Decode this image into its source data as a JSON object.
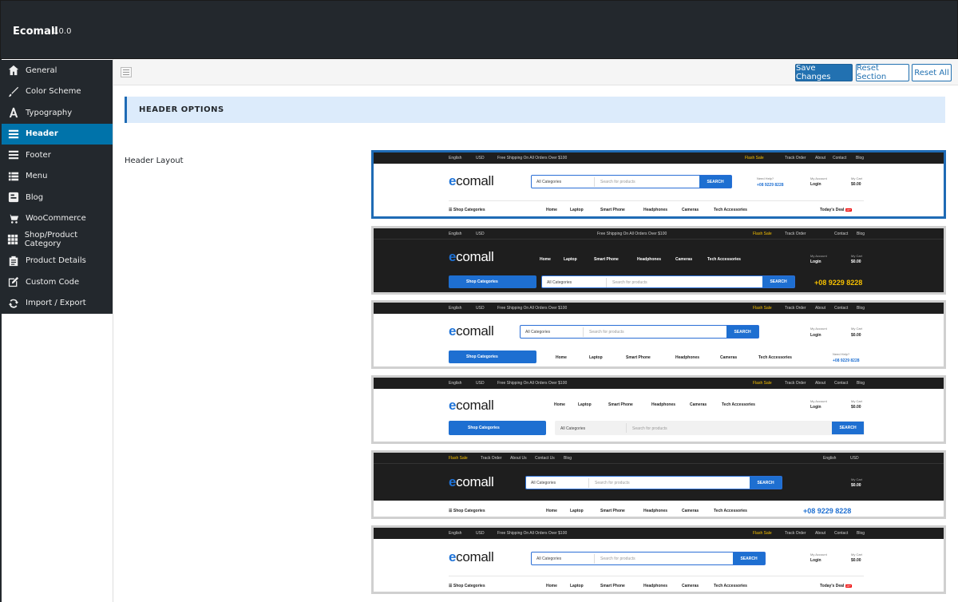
{
  "app": {
    "title": "Ecomall",
    "version": "1.0.0"
  },
  "sidebar": {
    "items": [
      {
        "label": "General",
        "icon": "home-icon"
      },
      {
        "label": "Color Scheme",
        "icon": "brush-icon"
      },
      {
        "label": "Typography",
        "icon": "typography-icon"
      },
      {
        "label": "Header",
        "icon": "menu-lines-icon",
        "active": true
      },
      {
        "label": "Footer",
        "icon": "menu-lines-icon"
      },
      {
        "label": "Menu",
        "icon": "list-icon"
      },
      {
        "label": "Blog",
        "icon": "blog-icon"
      },
      {
        "label": "WooCommerce",
        "icon": "cart-icon"
      },
      {
        "label": "Shop/Product Category",
        "icon": "grid-icon"
      },
      {
        "label": "Product Details",
        "icon": "clipboard-icon"
      },
      {
        "label": "Custom Code",
        "icon": "edit-icon"
      },
      {
        "label": "Import / Export",
        "icon": "sync-icon"
      }
    ]
  },
  "toolbar": {
    "save_label": "Save Changes",
    "reset_section_label": "Reset Section",
    "reset_all_label": "Reset All"
  },
  "section": {
    "title": "HEADER OPTIONS"
  },
  "field": {
    "label": "Header Layout"
  },
  "preview": {
    "lang": "English",
    "currency": "USD",
    "shipping": "Free Shipping On All Orders Over $100",
    "flash_sale": "Flash Sale",
    "track_order": "Track Order",
    "about": "About",
    "about_us": "About Us",
    "contact": "Contact",
    "contact_us": "Contact Us",
    "blog": "Blog",
    "logo_e": "e",
    "logo_rest": "comall",
    "all_categories": "All Categories",
    "search_placeholder": "Search for products",
    "search_button": "SEARCH",
    "need_help": "Need Help?",
    "phone": "+08 9229 8228",
    "my_account": "My Account",
    "login": "Login",
    "my_cart": "My Cart",
    "cart_total": "$0.00",
    "shop_categories": "Shop Categories",
    "home": "Home",
    "laptop": "Laptop",
    "smart_phone": "Smart Phone",
    "headphones": "Headphones",
    "cameras": "Cameras",
    "tech_accessories": "Tech Accessories",
    "todays_deal": "Today's Deal",
    "hot": "HOT"
  },
  "colors": {
    "accent": "#0073aa",
    "primary_blue": "#1e6fd1",
    "flash": "#f6c000",
    "dark": "#23282d"
  }
}
